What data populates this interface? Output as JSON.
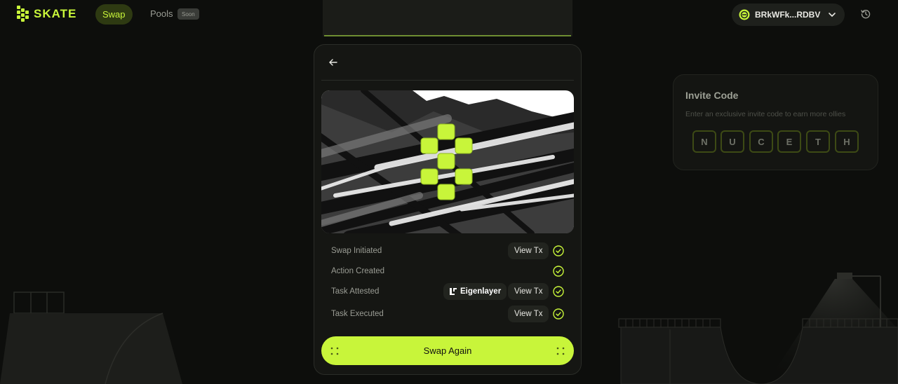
{
  "nav": {
    "brand": "SKATE",
    "swap_label": "Swap",
    "pools_label": "Pools",
    "soon_badge": "Soon",
    "wallet_address": "BRkWFk...RDBV"
  },
  "swap_card": {
    "steps": [
      {
        "label": "Swap Initiated",
        "view_tx": "View Tx"
      },
      {
        "label": "Action Created"
      },
      {
        "label": "Task Attested",
        "provider": "Eigenlayer",
        "view_tx": "View Tx"
      },
      {
        "label": "Task Executed",
        "view_tx": "View Tx"
      }
    ],
    "cta_label": "Swap Again"
  },
  "invite": {
    "title": "Invite Code",
    "subtitle": "Enter an exclusive invite code to earn more ollies",
    "code": [
      "N",
      "U",
      "C",
      "E",
      "T",
      "H"
    ]
  },
  "colors": {
    "accent": "#c8f53a",
    "background": "#0d0e0c",
    "card": "#151613"
  }
}
